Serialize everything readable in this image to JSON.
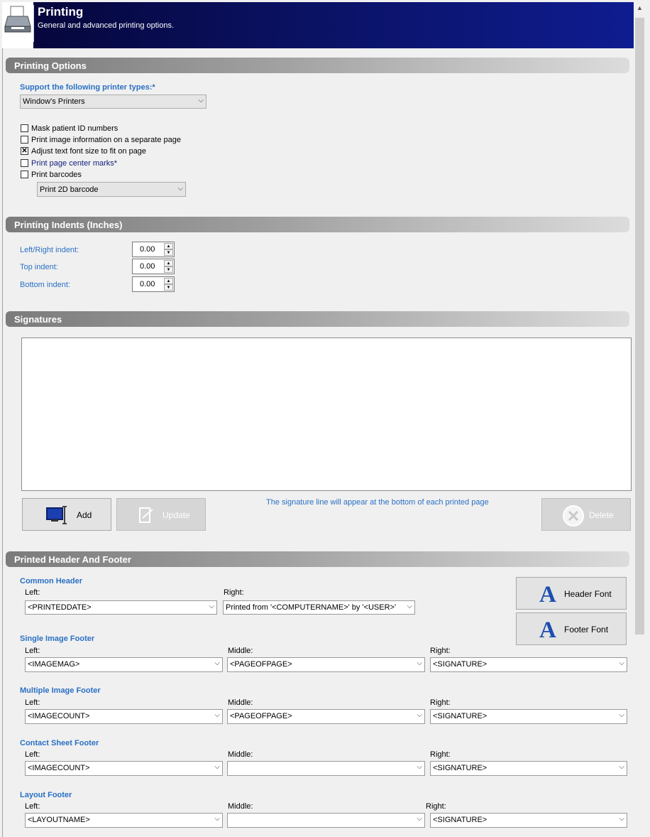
{
  "header": {
    "title": "Printing",
    "subtitle": "General and advanced printing options."
  },
  "printing_options": {
    "section_title": "Printing Options",
    "printer_types_label": "Support the following printer types:*",
    "printer_type_value": "Window's Printers",
    "checkboxes": [
      {
        "label": "Mask patient ID numbers",
        "checked": false
      },
      {
        "label": "Print image information on a separate page",
        "checked": false
      },
      {
        "label": "Adjust text font size to fit on page",
        "checked": true
      },
      {
        "label": "Print page center marks*",
        "checked": false
      },
      {
        "label": "Print barcodes",
        "checked": false
      }
    ],
    "barcode_value": "Print 2D barcode"
  },
  "indents": {
    "section_title": "Printing Indents (Inches)",
    "left_right_label": "Left/Right indent:",
    "left_right_value": "0.00",
    "top_label": "Top indent:",
    "top_value": "0.00",
    "bottom_label": "Bottom indent:",
    "bottom_value": "0.00"
  },
  "signatures": {
    "section_title": "Signatures",
    "add_label": "Add",
    "update_label": "Update",
    "delete_label": "Delete",
    "note": "The signature line will appear at the bottom of each printed page"
  },
  "header_footer": {
    "section_title": "Printed Header And Footer",
    "header_font_label": "Header Font",
    "footer_font_label": "Footer Font",
    "left_label": "Left:",
    "middle_label": "Middle:",
    "right_label": "Right:",
    "common_header": {
      "title": "Common Header",
      "left": "<PRINTEDDATE>",
      "right": "Printed from '<COMPUTERNAME>' by '<USER>'"
    },
    "single_image_footer": {
      "title": "Single Image Footer",
      "left": "<IMAGEMAG>",
      "middle": "<PAGEOFPAGE>",
      "right": "<SIGNATURE>"
    },
    "multiple_image_footer": {
      "title": "Multiple Image Footer",
      "left": "<IMAGECOUNT>",
      "middle": "<PAGEOFPAGE>",
      "right": "<SIGNATURE>"
    },
    "contact_sheet_footer": {
      "title": "Contact Sheet Footer",
      "left": "<IMAGECOUNT>",
      "middle": "",
      "right": "<SIGNATURE>"
    },
    "layout_footer": {
      "title": "Layout Footer",
      "left": "<LAYOUTNAME>",
      "middle": "",
      "right": "<SIGNATURE>"
    }
  },
  "colors": {
    "label_blue": "#2a70c4",
    "banner": "#0a1160"
  }
}
